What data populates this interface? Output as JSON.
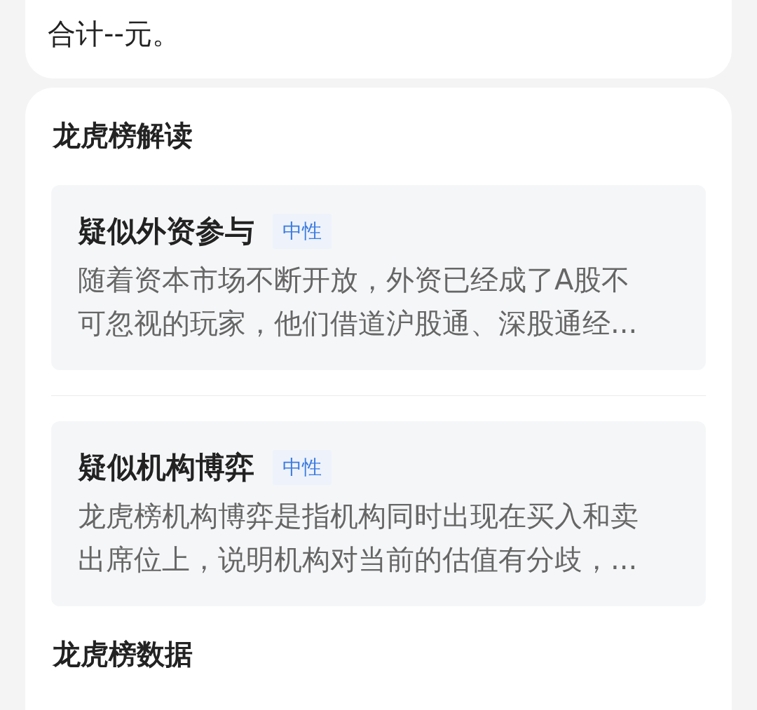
{
  "summary_card": {
    "text": "合计--元。"
  },
  "analysis": {
    "title": "龙虎榜解读",
    "items": [
      {
        "title": "疑似外资参与",
        "tag": "中性",
        "description": "随着资本市场不断开放，外资已经成了A股不可忽视的玩家，他们借道沪股通、深股通经..."
      },
      {
        "title": "疑似机构博弈",
        "tag": "中性",
        "description": "龙虎榜机构博弈是指机构同时出现在买入和卖出席位上，说明机构对当前的估值有分歧，..."
      }
    ]
  },
  "data_section": {
    "title": "龙虎榜数据"
  }
}
